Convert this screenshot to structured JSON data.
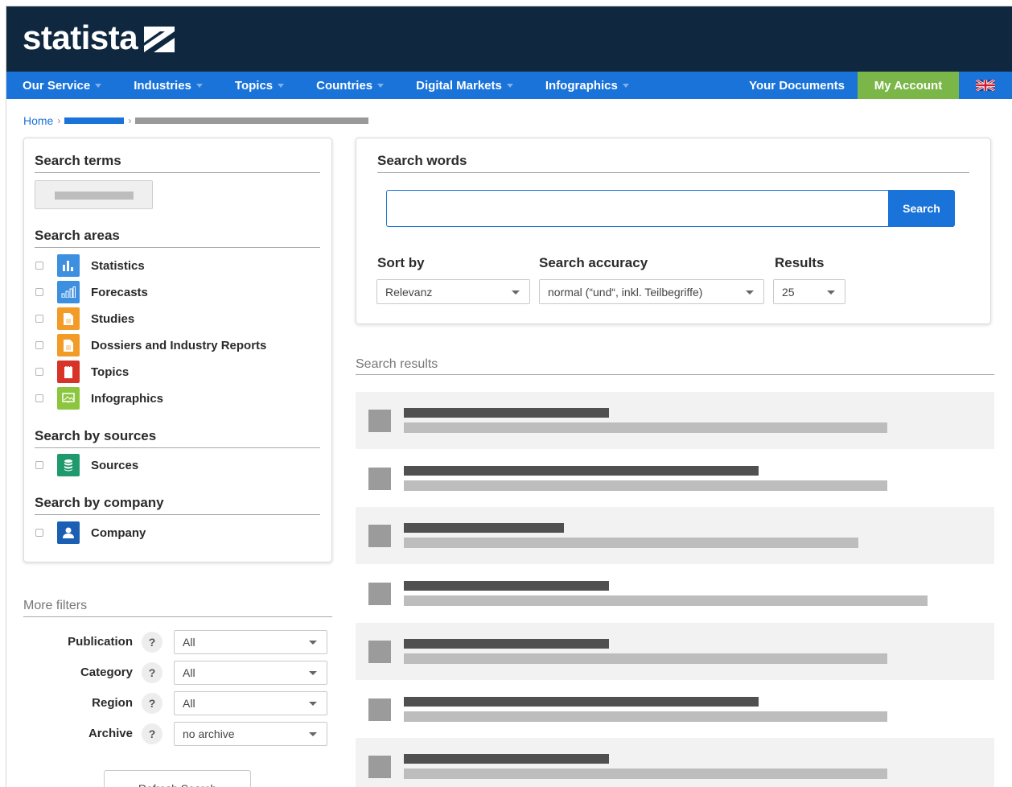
{
  "header": {
    "logo_text": "statista"
  },
  "nav": {
    "items": [
      {
        "label": "Our Service"
      },
      {
        "label": "Industries"
      },
      {
        "label": "Topics"
      },
      {
        "label": "Countries"
      },
      {
        "label": "Digital Markets"
      },
      {
        "label": "Infographics"
      }
    ],
    "your_documents": "Your Documents",
    "my_account": "My Account",
    "language_icon": "uk-flag-icon"
  },
  "breadcrumb": {
    "home": "Home",
    "sep": "›"
  },
  "left_panel": {
    "search_terms_title": "Search  terms",
    "search_areas_title": "Search areas",
    "areas": [
      {
        "label": "Statistics",
        "icon": "bar-chart-icon",
        "color": "#3d8fe0"
      },
      {
        "label": "Forecasts",
        "icon": "forecast-chart-icon",
        "color": "#3d8fe0"
      },
      {
        "label": "Studies",
        "icon": "document-icon",
        "color": "#f39b27"
      },
      {
        "label": "Dossiers and Industry Reports",
        "icon": "document-icon",
        "color": "#f39b27"
      },
      {
        "label": "Topics",
        "icon": "notebook-icon",
        "color": "#d83327"
      },
      {
        "label": "Infographics",
        "icon": "image-icon",
        "color": "#8cc63f"
      }
    ],
    "sources_title": "Search by sources",
    "sources": {
      "label": "Sources",
      "icon": "database-icon",
      "color": "#1f9a6d"
    },
    "company_title": "Search by company",
    "company": {
      "label": "Company",
      "icon": "person-icon",
      "color": "#1a5fb4"
    }
  },
  "more_filters": {
    "title": "More filters",
    "help": "?",
    "filters": [
      {
        "label": "Publication",
        "value": "All"
      },
      {
        "label": "Category",
        "value": "All"
      },
      {
        "label": "Region",
        "value": "All"
      },
      {
        "label": "Archive",
        "value": "no archive"
      }
    ],
    "refresh_label": "Refresh Search"
  },
  "search_panel": {
    "title": "Search words",
    "search_value": "",
    "search_button": "Search",
    "sort_by_label": "Sort by",
    "sort_by_value": "Relevanz",
    "accuracy_label": "Search accuracy",
    "accuracy_value": "normal (“und“, inkl. Teilbegriffe)",
    "results_label": "Results",
    "results_value": "25"
  },
  "results": {
    "title": "Search results",
    "count": 7
  },
  "colors": {
    "header_bg": "#0f2840",
    "nav_bg": "#1a73d9",
    "account_bg": "#7ab648"
  }
}
